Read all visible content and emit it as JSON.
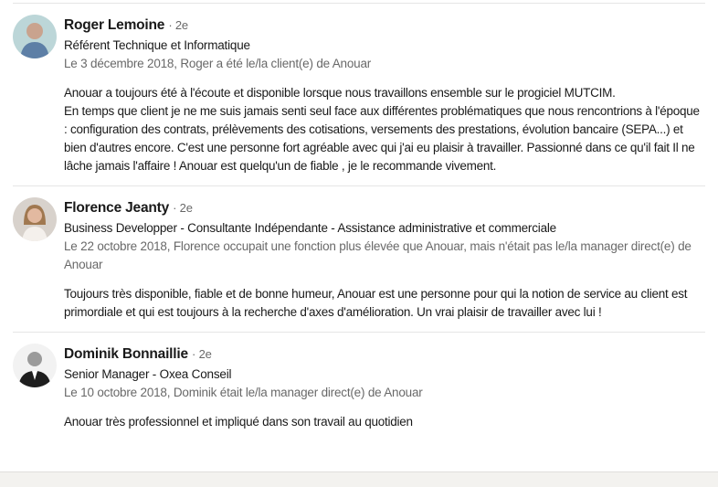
{
  "recommendations": [
    {
      "name": "Roger Lemoine",
      "degree": "· 2e",
      "title": "Référent Technique et Informatique",
      "relation": "Le 3 décembre 2018, Roger a été le/la client(e) de Anouar",
      "text": "Anouar a toujours été à l'écoute et disponible lorsque nous travaillons ensemble sur le progiciel MUTCIM.\nEn temps que client je ne me suis jamais senti seul face aux différentes problématiques que nous rencontrions à l'époque : configuration des contrats, prélèvements des cotisations, versements des prestations, évolution bancaire (SEPA...) et bien d'autres encore. C'est une personne fort agréable avec qui j'ai eu plaisir à travailler. Passionné dans ce qu'il fait Il ne lâche jamais l'affaire ! Anouar est quelqu'un de fiable , je le recommande vivement."
    },
    {
      "name": "Florence Jeanty",
      "degree": "· 2e",
      "title": "Business Developper - Consultante Indépendante - Assistance administrative et commerciale",
      "relation": "Le 22 octobre 2018, Florence occupait une fonction plus élevée que Anouar, mais n'était pas le/la manager direct(e) de Anouar",
      "text": "Toujours très disponible, fiable et de bonne humeur, Anouar est une personne pour qui la notion de service au client est primordiale et qui est toujours à la recherche d'axes d'amélioration. Un vrai plaisir de travailler avec lui !"
    },
    {
      "name": "Dominik Bonnaillie",
      "degree": "· 2e",
      "title": "Senior Manager - Oxea Conseil",
      "relation": "Le 10 octobre 2018, Dominik était le/la manager direct(e) de Anouar",
      "text": "Anouar très professionnel et impliqué dans son travail au quotidien"
    }
  ]
}
